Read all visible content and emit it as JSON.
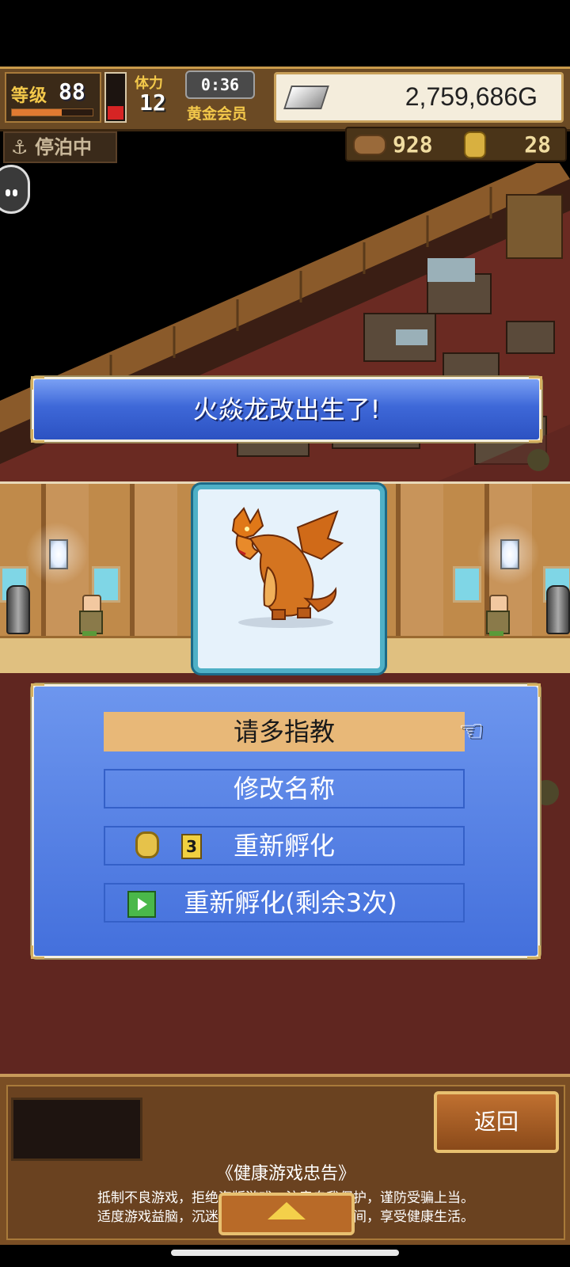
{
  "hud": {
    "level_label": "等级",
    "level_value": "88",
    "xp_progress": 0.62,
    "stamina_label": "体力",
    "stamina_value": "12",
    "stamina_level": 0.3,
    "timer": "0:36",
    "membership": "黄金会员",
    "gold": "2,759,686G",
    "docked_status": "停泊中",
    "resource_logs": "928",
    "resource_medals": "28"
  },
  "dialog": {
    "title": "火焱龙改出生了!"
  },
  "menu": {
    "options": [
      {
        "label": "请多指教",
        "selected": true
      },
      {
        "label": "修改名称"
      },
      {
        "label": "重新孵化",
        "cost": "3"
      },
      {
        "label": "重新孵化(剩余3次)"
      }
    ]
  },
  "footer": {
    "back_label": "返回",
    "advisory_title": "《健康游戏忠告》",
    "advisory_line1": "抵制不良游戏，拒绝盗版游戏。注意自我保护，谨防受骗上当。",
    "advisory_line2": "适度游戏益脑，沉迷游戏伤身。合理安排时间，享受健康生活。"
  },
  "icons": {
    "pointer": "pointing-hand-icon",
    "coin": "gold-coin-icon",
    "video": "video-play-icon",
    "anchor": "anchor-icon",
    "silver": "silver-ingot-icon"
  },
  "colors": {
    "banner_blue": "#3e68d8",
    "menu_blue": "#5480e4",
    "selected_option": "#e8b878",
    "card_border": "#4fb0c6"
  }
}
